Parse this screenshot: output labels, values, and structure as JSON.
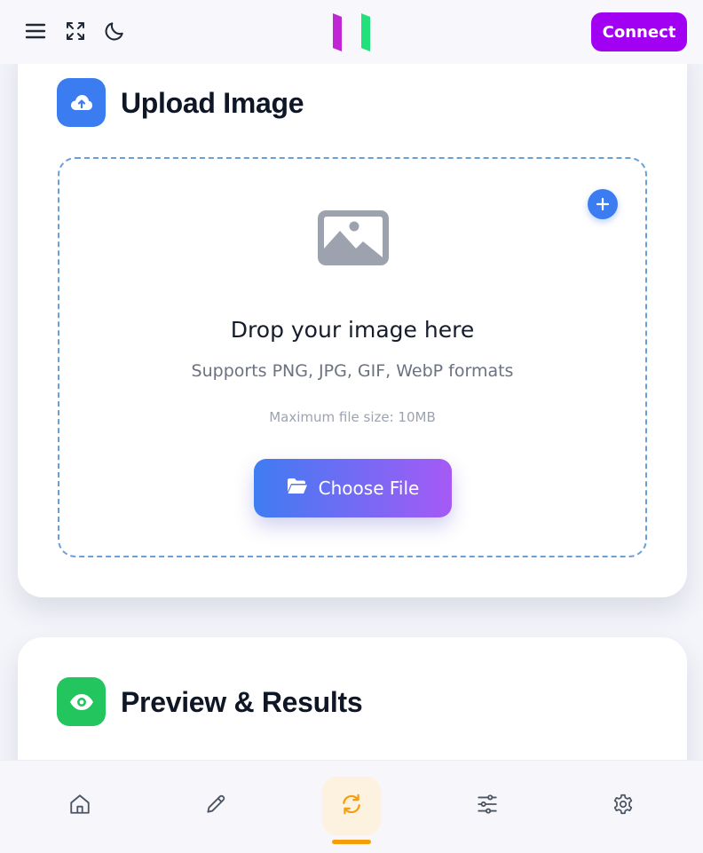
{
  "header": {
    "menu_icon": "hamburger-menu-icon",
    "fullscreen_icon": "expand-arrows-icon",
    "theme_icon": "moon-icon",
    "logo": "app-logo",
    "connect_label": "Connect"
  },
  "upload": {
    "title": "Upload Image",
    "icon": "cloud-upload-icon",
    "add_icon": "plus-icon",
    "image_icon": "image-placeholder-icon",
    "drop_title": "Drop your image here",
    "formats_text": "Supports PNG, JPG, GIF, WebP formats",
    "max_size_text": "Maximum file size: 10MB",
    "choose_label": "Choose File",
    "choose_icon": "folder-open-icon"
  },
  "preview": {
    "title": "Preview & Results",
    "icon": "eye-icon"
  },
  "bottom_nav": {
    "items": [
      {
        "icon": "home-icon",
        "active": false
      },
      {
        "icon": "pencil-icon",
        "active": false
      },
      {
        "icon": "sync-icon",
        "active": true
      },
      {
        "icon": "sliders-icon",
        "active": false
      },
      {
        "icon": "gear-icon",
        "active": false
      }
    ]
  },
  "colors": {
    "accent_purple": "#a100f2",
    "blue": "#3b7cf0",
    "green": "#22c55e",
    "active_orange": "#f59e0b",
    "logo_magenta": "#c026d3",
    "logo_green": "#22e07a"
  }
}
